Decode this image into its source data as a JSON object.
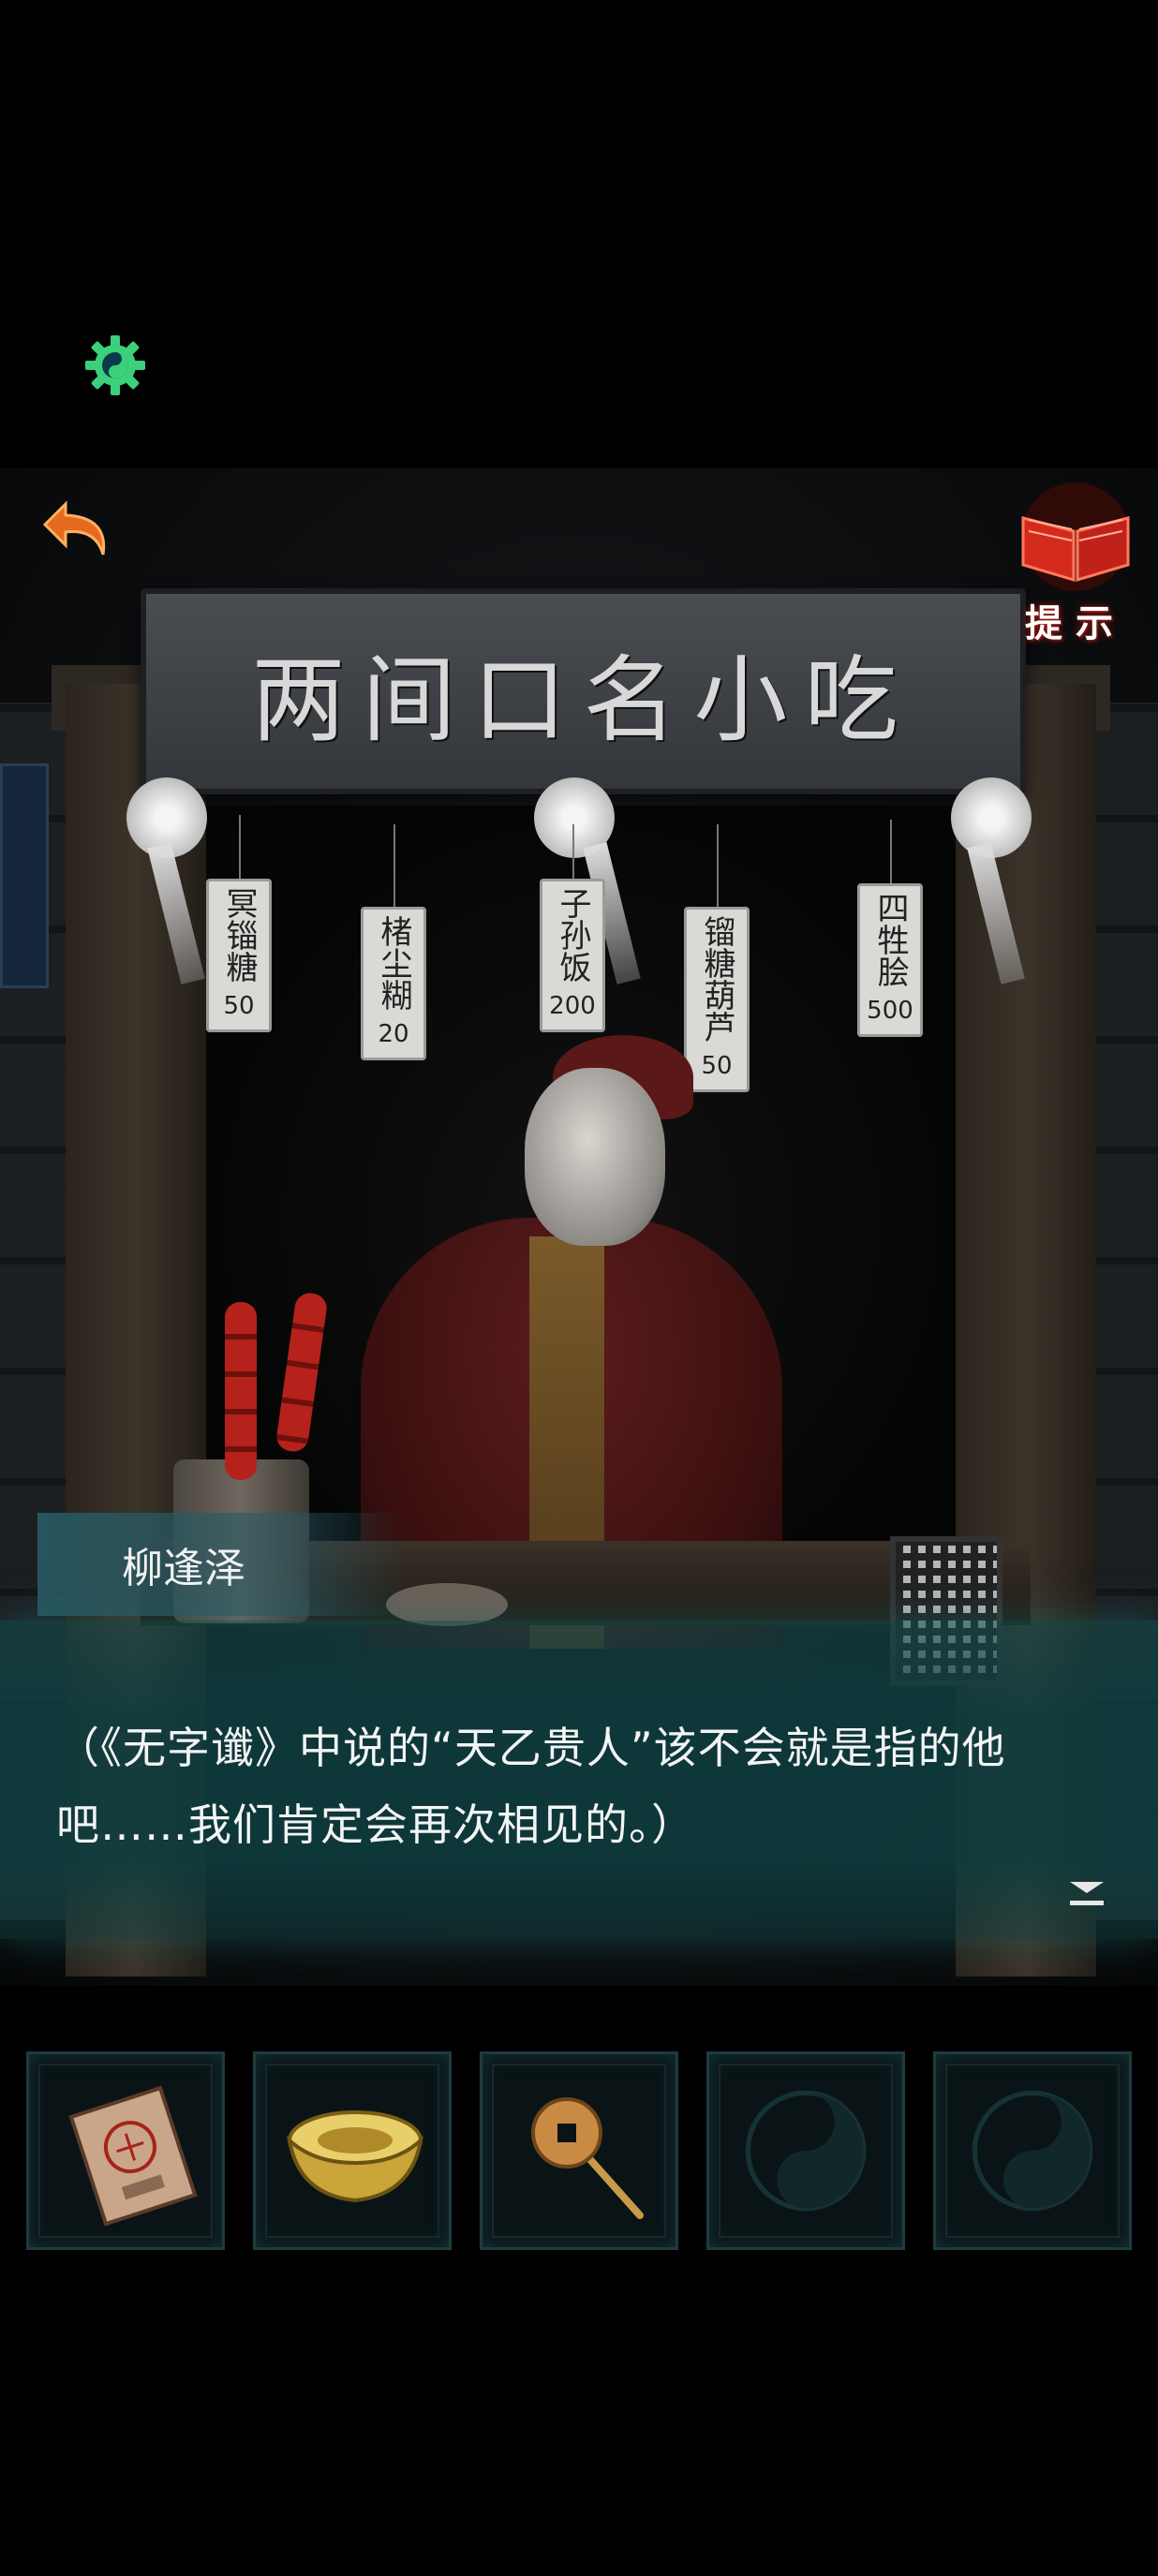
{
  "scene": {
    "signboard_text": "两间口名小吃",
    "menu_items": [
      {
        "name": "冥锱糖",
        "price": "50"
      },
      {
        "name": "楮尘糊",
        "price": "20"
      },
      {
        "name": "子孙饭",
        "price": "200"
      },
      {
        "name": "镏糖葫芦",
        "price": "50"
      },
      {
        "name": "四牲脍",
        "price": "500"
      }
    ]
  },
  "hud": {
    "settings_icon": "gear-yinyang-icon",
    "back_icon": "back-arrow-icon",
    "hint_icon": "open-book-icon",
    "hint_label": "提示"
  },
  "dialogue": {
    "speaker": "柳逢泽",
    "text": "（《无字谶》中说的“天乙贵人”该不会就是指的他吧……我们肯定会再次相见的。）",
    "advance_icon": "double-chevron-down-icon"
  },
  "inventory": {
    "slots": [
      {
        "item": "talisman-book",
        "filled": true
      },
      {
        "item": "gold-ingot",
        "filled": true
      },
      {
        "item": "copper-coin-stick",
        "filled": true
      },
      {
        "item": "",
        "filled": false
      },
      {
        "item": "",
        "filled": false
      }
    ]
  },
  "colors": {
    "accent_teal": "#1f6f73",
    "hint_red": "#c0281c",
    "gear_green": "#3bd17a"
  }
}
